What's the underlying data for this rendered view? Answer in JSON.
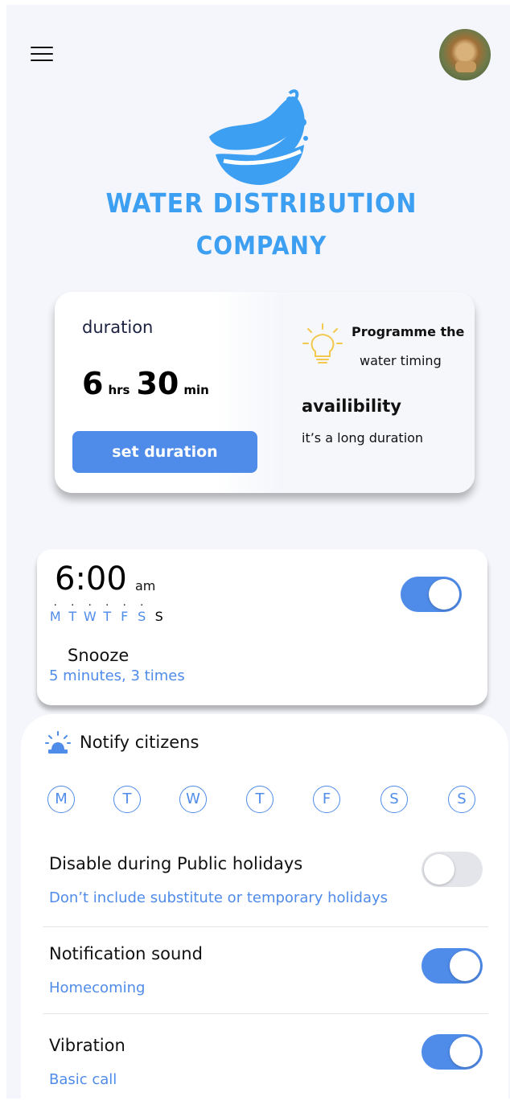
{
  "header": {
    "menu_icon": "hamburger-menu-icon",
    "avatar": "user-avatar"
  },
  "brand": {
    "line1": "WATER DISTRIBUTION",
    "line2": "COMPANY",
    "logo": "water-wave-logo",
    "color": "#3d9ff2"
  },
  "duration": {
    "label": "duration",
    "hours": "6",
    "hours_unit": "hrs",
    "minutes": "30",
    "minutes_unit": "min",
    "button_label": "set duration",
    "program_line1": "Programme the",
    "program_line2": "water timing",
    "availability_title": "availibility",
    "availability_sub": "it’s a long duration",
    "bulb_icon": "lightbulb-icon"
  },
  "alarm": {
    "time": "6:00",
    "ampm": "am",
    "days": [
      "M",
      "T",
      "W",
      "T",
      "F",
      "S",
      "S"
    ],
    "enabled": true,
    "snooze_title": "Snooze",
    "snooze_detail": "5 minutes, 3 times"
  },
  "notify": {
    "icon": "siren-alarm-icon",
    "title": "Notify citizens",
    "days": [
      "M",
      "T",
      "W",
      "T",
      "F",
      "S",
      "S"
    ],
    "settings": [
      {
        "title": "Disable during Public holidays",
        "subtitle": "Don’t include substitute or temporary holidays",
        "enabled": false
      },
      {
        "title": "Notification sound",
        "subtitle": "Homecoming",
        "enabled": true
      },
      {
        "title": "Vibration",
        "subtitle": "Basic call",
        "enabled": true
      }
    ]
  },
  "colors": {
    "accent": "#4f8be9",
    "background": "#f4f6fb"
  }
}
